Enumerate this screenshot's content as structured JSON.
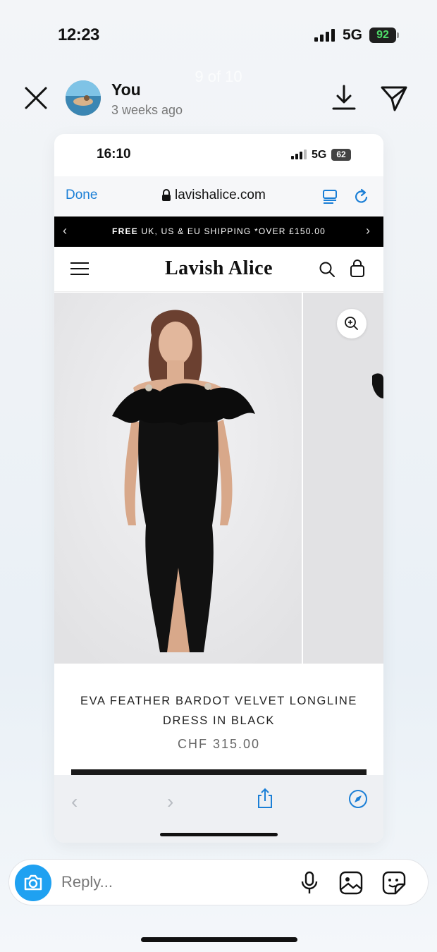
{
  "outer_status": {
    "time": "12:23",
    "network": "5G",
    "battery": "92"
  },
  "story": {
    "counter": "9 of 10",
    "username": "You",
    "timestamp": "3 weeks ago"
  },
  "inner_status": {
    "time": "16:10",
    "network": "5G",
    "battery": "62"
  },
  "browser": {
    "done_label": "Done",
    "url": "lavishalice.com"
  },
  "promo": {
    "bold": "FREE",
    "text": " UK, US & EU SHIPPING *OVER £150.00",
    "prev": "‹",
    "next": "›"
  },
  "site": {
    "logo": "Lavish Alice"
  },
  "product": {
    "title": "EVA FEATHER BARDOT VELVET LONGLINE DRESS IN BLACK",
    "price": "CHF 315.00"
  },
  "browser_nav": {
    "back": "‹",
    "forward": "›"
  },
  "reply": {
    "placeholder": "Reply..."
  },
  "colors": {
    "accent_blue": "#1b7fd6",
    "camera_blue": "#1fa1f1",
    "battery_green": "#4fe06a"
  },
  "icons": [
    "close-icon",
    "download-icon",
    "send-icon",
    "lock-icon",
    "reader-icon",
    "reload-icon",
    "menu-icon",
    "search-icon",
    "bag-icon",
    "zoom-icon",
    "share-icon",
    "compass-icon",
    "camera-icon",
    "mic-icon",
    "gallery-icon",
    "sticker-icon"
  ]
}
